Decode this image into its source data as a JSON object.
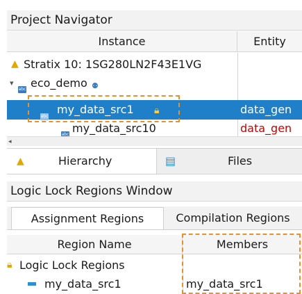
{
  "navigator": {
    "title": "Project Navigator",
    "columns": [
      "Instance",
      "Entity"
    ],
    "rows": [
      {
        "name": "Stratix 10: 1SG280LN2F43E1VG",
        "entity": ""
      },
      {
        "name": "eco_demo",
        "entity": ""
      },
      {
        "name": "my_data_src1",
        "entity": "data_gen",
        "selected": true
      },
      {
        "name": "my_data_src10",
        "entity": "data_gen"
      }
    ],
    "tabs": [
      "Hierarchy",
      "Files"
    ],
    "colors": {
      "selection": "#1f7fc9",
      "entity_red": "#cc0000",
      "warning": "#e0a800",
      "dashed": "#e8902a"
    }
  },
  "logic_lock": {
    "title": "Logic Lock Regions Window",
    "tabs": [
      "Assignment Regions",
      "Compilation Regions"
    ],
    "active_tab": "Assignment Regions",
    "columns": [
      "Region Name",
      "Members"
    ],
    "rows": [
      {
        "name": "Logic Lock Regions",
        "members": ""
      },
      {
        "name": "my_data_src1",
        "members": "my_data_src1"
      }
    ]
  },
  "icons": [
    "warning-triangle-icon",
    "expand-arrow-icon",
    "instance-icon",
    "hierarchy-icon",
    "lock-icon",
    "region-icon",
    "file-icon"
  ]
}
